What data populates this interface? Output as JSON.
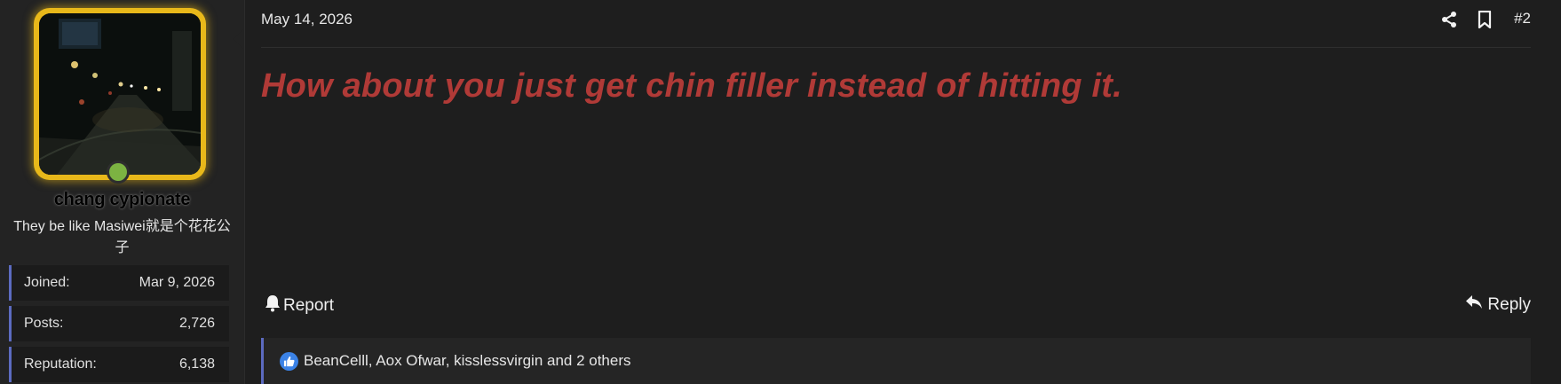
{
  "user": {
    "username": "chang cypionate",
    "title": "They be like Masiwei就是个花花公子",
    "online": true,
    "stats": [
      {
        "label": "Joined:",
        "value": "Mar 9, 2026"
      },
      {
        "label": "Posts:",
        "value": "2,726"
      },
      {
        "label": "Reputation:",
        "value": "6,138"
      }
    ]
  },
  "post": {
    "date": "May 14, 2026",
    "number": "#2",
    "body": "How about you just get chin filler instead of hitting it.",
    "body_color": "#b03a37",
    "share_icon": "share-icon",
    "bookmark_icon": "bookmark-icon"
  },
  "actions": {
    "report_label": "Report",
    "reply_label": "Reply"
  },
  "reactions": {
    "text": "BeanCelll, Aox Ofwar, kisslessvirgin and 2 others",
    "icon": "thumbs-up-icon",
    "icon_color": "#3b82e6"
  },
  "colors": {
    "avatar_border": "#e8b81a",
    "online_dot": "#7cb342",
    "accent_bar": "#5c6bc0"
  }
}
